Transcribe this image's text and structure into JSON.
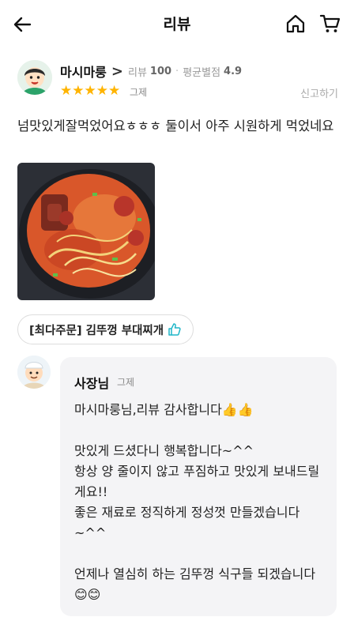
{
  "header": {
    "title": "리뷰",
    "back_icon": "arrow-left-icon",
    "home_icon": "home-icon",
    "cart_icon": "cart-icon"
  },
  "review": {
    "reviewer_name": "마시마룽",
    "chevron": ">",
    "review_count_label": "리뷰",
    "review_count": "100",
    "separator": "·",
    "avg_rating_label": "평균별점",
    "avg_rating": "4.9",
    "stars": "★★★★★",
    "rating": 5,
    "date": "그제",
    "report_label": "신고하기",
    "text": "넘맛있게잘먹었어요ㅎㅎㅎ 둘이서 아주 시원하게 먹었네요",
    "photo_icon": "food-photo",
    "order_tag": "[최다주문] 김뚜껑 부대찌개",
    "thumbs_icon": "thumbs-up-icon"
  },
  "owner_reply": {
    "name": "사장님",
    "date": "그제",
    "text": "마시마룽님,리뷰 감사합니다👍👍\n\n맛있게 드셨다니 행복합니다~^^\n항상 양 줄이지 않고 푸짐하고 맛있게 보내드릴게요!!\n좋은 재료로 정직하게 정성껏 만들겠습니다~^^\n\n언제나 열심히 하는 김뚜껑 식구들 되겠습니다😊😊"
  },
  "colors": {
    "star": "#ffb400",
    "bubble_bg": "#f4f4f6",
    "thumbs": "#1fb6c8"
  }
}
